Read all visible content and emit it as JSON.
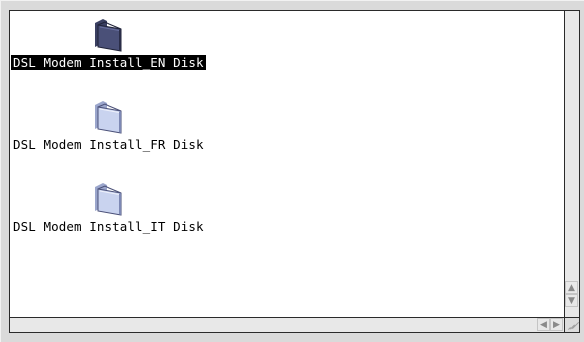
{
  "items": [
    {
      "label": "DSL Modem Install_EN Disk",
      "selected": true,
      "icon": "folder-icon"
    },
    {
      "label": "DSL Modem Install_FR Disk",
      "selected": false,
      "icon": "folder-icon"
    },
    {
      "label": "DSL Modem Install_IT Disk",
      "selected": false,
      "icon": "folder-icon"
    }
  ],
  "scroll_arrows": {
    "up": "▲",
    "down": "▼",
    "left": "◀",
    "right": "▶"
  },
  "colors": {
    "folder_light": "#c9d3ef",
    "folder_selected": "#4a5078"
  }
}
